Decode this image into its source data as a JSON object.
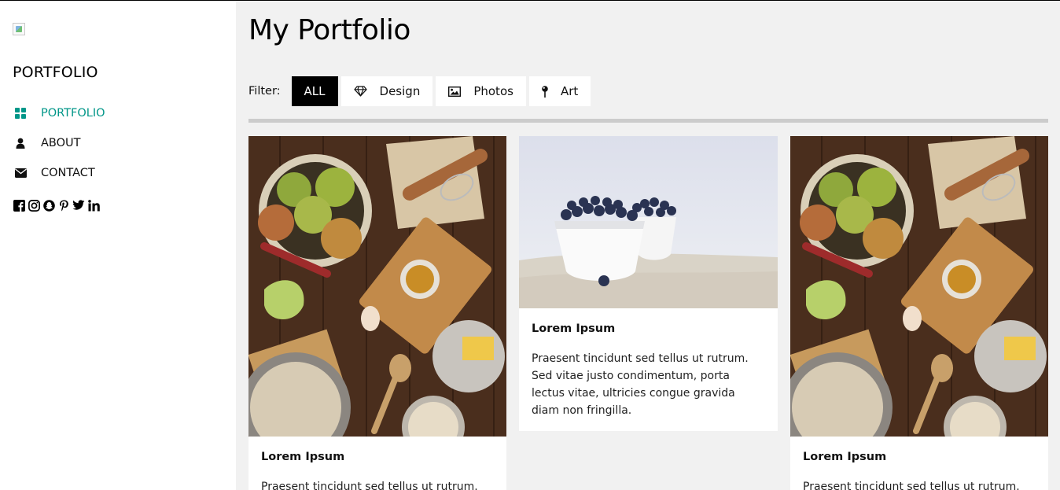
{
  "sidebar": {
    "brand": "PORTFOLIO",
    "nav": [
      {
        "label": "PORTFOLIO",
        "icon": "th-large-icon",
        "active": true
      },
      {
        "label": "ABOUT",
        "icon": "user-icon",
        "active": false
      },
      {
        "label": "CONTACT",
        "icon": "envelope-icon",
        "active": false
      }
    ],
    "social": [
      "facebook-icon",
      "instagram-icon",
      "snapchat-icon",
      "pinterest-icon",
      "twitter-icon",
      "linkedin-icon"
    ]
  },
  "main": {
    "title": "My Portfolio",
    "filter": {
      "label": "Filter:",
      "buttons": [
        {
          "label": "ALL",
          "active": true
        },
        {
          "label": "Design",
          "icon": "diamond-icon"
        },
        {
          "label": "Photos",
          "icon": "photo-icon"
        },
        {
          "label": "Art",
          "icon": "map-pin-icon"
        }
      ]
    },
    "cards": [
      {
        "title": "Lorem Ipsum",
        "text": "Praesent tincidunt sed tellus ut rutrum.",
        "image": "kitchen-ingredients-image"
      },
      {
        "title": "Lorem Ipsum",
        "text": "Praesent tincidunt sed tellus ut rutrum. Sed vitae justo condimentum, porta lectus vitae, ultricies congue gravida diam non fringilla.",
        "image": "blueberries-bowl-image"
      },
      {
        "title": "Lorem Ipsum",
        "text": "Praesent tincidunt sed tellus ut rutrum.",
        "image": "kitchen-ingredients-image"
      }
    ]
  },
  "colors": {
    "accent": "#009688",
    "page_bg": "#f1f1f1",
    "sidebar_bg": "#ffffff",
    "divider": "#cccccc",
    "active_filter_bg": "#000000"
  }
}
